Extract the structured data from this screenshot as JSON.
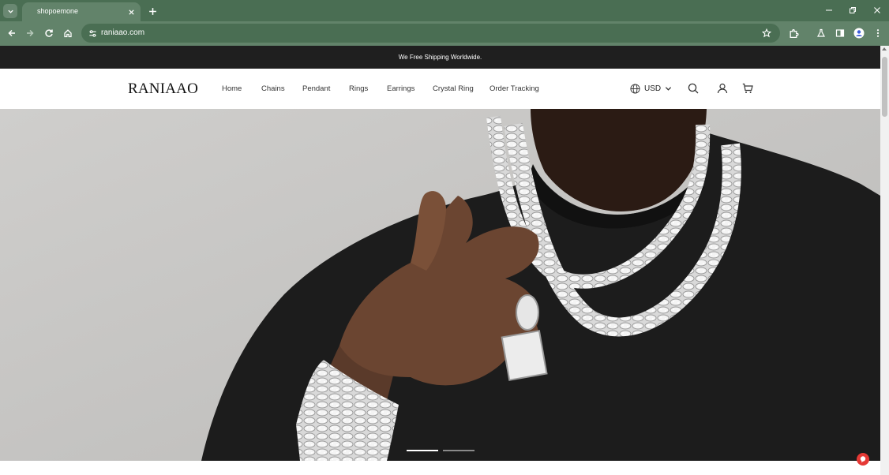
{
  "browser": {
    "tab_title": "shopoemone",
    "url": "raniaao.com"
  },
  "announcement": {
    "text": "We Free Shipping Worldwide."
  },
  "header": {
    "logo": "RANIAAO",
    "nav": [
      "Home",
      "Chains",
      "Pendant",
      "Rings",
      "Earrings",
      "Crystal Ring",
      "Order Tracking"
    ],
    "currency": "USD",
    "icons": [
      "globe-icon",
      "search-icon",
      "account-icon",
      "cart-icon"
    ]
  },
  "hero": {
    "image_subject": "man in black t-shirt wearing iced-out cuban link chains and bracelet",
    "slides_total": 2,
    "active_slide": 1
  },
  "colors": {
    "browser_frame": "#4a6e53",
    "browser_toolbar": "#62836a",
    "announcement_bar": "#1f1f1f",
    "chat_button": "#e53935"
  }
}
